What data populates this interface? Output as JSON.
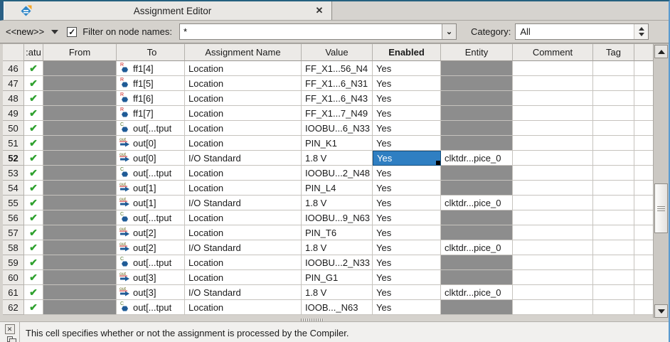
{
  "tab": {
    "title": "Assignment Editor",
    "close_glyph": "✕"
  },
  "toolbar": {
    "new_label": "<<new>>",
    "filter_checkbox_checked": true,
    "check_glyph": "✓",
    "filter_label": "Filter on node names:",
    "filter_value": "*",
    "combo_arrow_glyph": "⌄",
    "category_label": "Category:",
    "category_value": "All"
  },
  "table": {
    "columns": [
      "",
      ":atu",
      "From",
      "To",
      "Assignment Name",
      "Value",
      "Enabled",
      "Entity",
      "Comment",
      "Tag"
    ],
    "status_check_glyph": "✔",
    "icon_letters": {
      "register": "R",
      "combinational": "C",
      "output": "out"
    },
    "rows": [
      {
        "num": "46",
        "icon": "register",
        "to": "ff1[4]",
        "name": "Location",
        "value": "FF_X1...56_N4",
        "enabled": "Yes",
        "entity": "",
        "selected": false
      },
      {
        "num": "47",
        "icon": "register",
        "to": "ff1[5]",
        "name": "Location",
        "value": "FF_X1...6_N31",
        "enabled": "Yes",
        "entity": "",
        "selected": false
      },
      {
        "num": "48",
        "icon": "register",
        "to": "ff1[6]",
        "name": "Location",
        "value": "FF_X1...6_N43",
        "enabled": "Yes",
        "entity": "",
        "selected": false
      },
      {
        "num": "49",
        "icon": "register",
        "to": "ff1[7]",
        "name": "Location",
        "value": "FF_X1...7_N49",
        "enabled": "Yes",
        "entity": "",
        "selected": false
      },
      {
        "num": "50",
        "icon": "combinational",
        "to": "out[...tput",
        "name": "Location",
        "value": "IOOBU...6_N33",
        "enabled": "Yes",
        "entity": "",
        "selected": false
      },
      {
        "num": "51",
        "icon": "output",
        "to": "out[0]",
        "name": "Location",
        "value": "PIN_K1",
        "enabled": "Yes",
        "entity": "",
        "selected": false
      },
      {
        "num": "52",
        "icon": "output",
        "to": "out[0]",
        "name": "I/O Standard",
        "value": "1.8 V",
        "enabled": "Yes",
        "entity": "clktdr...pice_0",
        "selected": true
      },
      {
        "num": "53",
        "icon": "combinational",
        "to": "out[...tput",
        "name": "Location",
        "value": "IOOBU...2_N48",
        "enabled": "Yes",
        "entity": "",
        "selected": false
      },
      {
        "num": "54",
        "icon": "output",
        "to": "out[1]",
        "name": "Location",
        "value": "PIN_L4",
        "enabled": "Yes",
        "entity": "",
        "selected": false
      },
      {
        "num": "55",
        "icon": "output",
        "to": "out[1]",
        "name": "I/O Standard",
        "value": "1.8 V",
        "enabled": "Yes",
        "entity": "clktdr...pice_0",
        "selected": false
      },
      {
        "num": "56",
        "icon": "combinational",
        "to": "out[...tput",
        "name": "Location",
        "value": "IOOBU...9_N63",
        "enabled": "Yes",
        "entity": "",
        "selected": false
      },
      {
        "num": "57",
        "icon": "output",
        "to": "out[2]",
        "name": "Location",
        "value": "PIN_T6",
        "enabled": "Yes",
        "entity": "",
        "selected": false
      },
      {
        "num": "58",
        "icon": "output",
        "to": "out[2]",
        "name": "I/O Standard",
        "value": "1.8 V",
        "enabled": "Yes",
        "entity": "clktdr...pice_0",
        "selected": false
      },
      {
        "num": "59",
        "icon": "combinational",
        "to": "out[...tput",
        "name": "Location",
        "value": "IOOBU...2_N33",
        "enabled": "Yes",
        "entity": "",
        "selected": false
      },
      {
        "num": "60",
        "icon": "output",
        "to": "out[3]",
        "name": "Location",
        "value": "PIN_G1",
        "enabled": "Yes",
        "entity": "",
        "selected": false
      },
      {
        "num": "61",
        "icon": "output",
        "to": "out[3]",
        "name": "I/O Standard",
        "value": "1.8 V",
        "enabled": "Yes",
        "entity": "clktdr...pice_0",
        "selected": false
      },
      {
        "num": "62",
        "icon": "combinational",
        "to": "out[...tput",
        "name": "Location",
        "value": "IOOB..._N63",
        "enabled": "Yes",
        "entity": "",
        "selected": false
      }
    ]
  },
  "status_bar": {
    "message": "This cell specifies whether or not the assignment is processed by the Compiler.",
    "close_glyph": "✕"
  }
}
